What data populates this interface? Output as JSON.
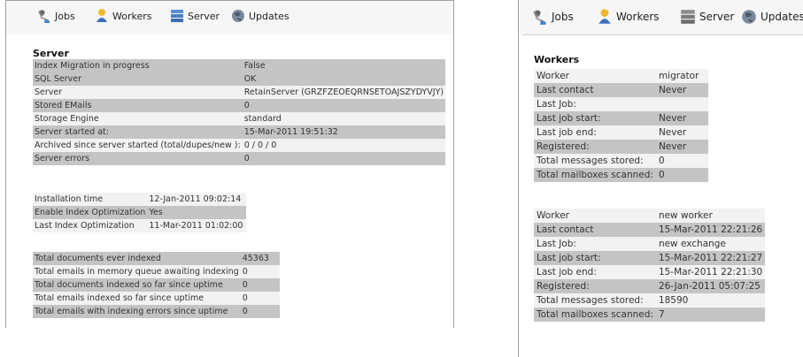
{
  "nav": {
    "jobs": "Jobs",
    "workers": "Workers",
    "server": "Server",
    "updates": "Updates"
  },
  "server": {
    "title": "Server",
    "rows": [
      {
        "label": "Index Migration in progress",
        "value": "False"
      },
      {
        "label": "SQL Server",
        "value": "OK"
      },
      {
        "label": "Server",
        "value": "RetainServer (GRZFZEOEQRNSETOAJSZYDYVJY)"
      },
      {
        "label": "Stored EMails",
        "value": "0"
      },
      {
        "label": "Storage Engine",
        "value": "standard"
      },
      {
        "label": "Server started at:",
        "value": "15-Mar-2011 19:51:32"
      },
      {
        "label": "Archived since server started (total/dupes/new ):",
        "value": "0 / 0 / 0"
      },
      {
        "label": "Server errors",
        "value": "0"
      }
    ],
    "index": [
      {
        "label": "Installation time",
        "value": "12-Jan-2011 09:02:14"
      },
      {
        "label": "Enable Index Optimization",
        "value": "Yes"
      },
      {
        "label": "Last Index Optimization",
        "value": "11-Mar-2011 01:02:00"
      }
    ],
    "stats": [
      {
        "label": "Total documents ever indexed",
        "value": "45363"
      },
      {
        "label": "Total emails in memory queue awaiting indexing",
        "value": "0"
      },
      {
        "label": "Total documents indexed so far since uptime",
        "value": "0"
      },
      {
        "label": "Total emails indexed so far since uptime",
        "value": "0"
      },
      {
        "label": "Total emails with indexing errors since uptime",
        "value": "0"
      }
    ]
  },
  "workers": {
    "title": "Workers",
    "list": [
      {
        "rows": [
          {
            "label": "Worker",
            "value": "migrator"
          },
          {
            "label": "Last contact",
            "value": "Never"
          },
          {
            "label": "Last Job:",
            "value": ""
          },
          {
            "label": "Last job start:",
            "value": "Never"
          },
          {
            "label": "Last job end:",
            "value": "Never"
          },
          {
            "label": "Registered:",
            "value": "Never"
          },
          {
            "label": "Total messages stored:",
            "value": "0"
          },
          {
            "label": "Total mailboxes scanned:",
            "value": "0"
          }
        ]
      },
      {
        "rows": [
          {
            "label": "Worker",
            "value": "new worker"
          },
          {
            "label": "Last contact",
            "value": "15-Mar-2011 22:21:26"
          },
          {
            "label": "Last Job:",
            "value": "new exchange"
          },
          {
            "label": "Last job start:",
            "value": "15-Mar-2011 22:21:27"
          },
          {
            "label": "Last job end:",
            "value": "15-Mar-2011 22:21:30"
          },
          {
            "label": "Registered:",
            "value": "26-Jan-2011 05:07:25"
          },
          {
            "label": "Total messages stored:",
            "value": "18590"
          },
          {
            "label": "Total mailboxes scanned:",
            "value": "7"
          }
        ]
      }
    ]
  }
}
